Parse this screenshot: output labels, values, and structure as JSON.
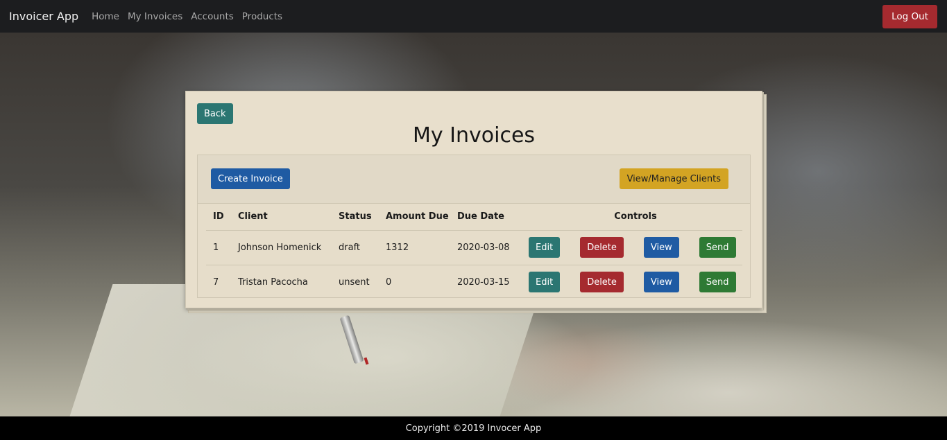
{
  "navbar": {
    "brand": "Invoicer App",
    "links": [
      "Home",
      "My Invoices",
      "Accounts",
      "Products"
    ],
    "logout_label": "Log Out"
  },
  "card": {
    "back_label": "Back",
    "title": "My Invoices",
    "create_label": "Create Invoice",
    "clients_label": "View/Manage Clients"
  },
  "table": {
    "headers": [
      "ID",
      "Client",
      "Status",
      "Amount Due",
      "Due Date",
      "Controls"
    ],
    "rows": [
      {
        "id": "1",
        "client": "Johnson Homenick",
        "status": "draft",
        "amount": "1312",
        "due": "2020-03-08"
      },
      {
        "id": "7",
        "client": "Tristan Pacocha",
        "status": "unsent",
        "amount": "0",
        "due": "2020-03-15"
      }
    ],
    "controls": {
      "edit": "Edit",
      "delete": "Delete",
      "view": "View",
      "send": "Send"
    }
  },
  "footer": {
    "text": "Copyright ©2019 Invocer App"
  },
  "colors": {
    "navbar_bg": "#1c1d1f",
    "danger": "#a52a2f",
    "teal": "#2b7672",
    "primary": "#1f5ba3",
    "warning": "#d3a423",
    "success": "#2e7a34",
    "card_bg": "#e8dfcc"
  }
}
